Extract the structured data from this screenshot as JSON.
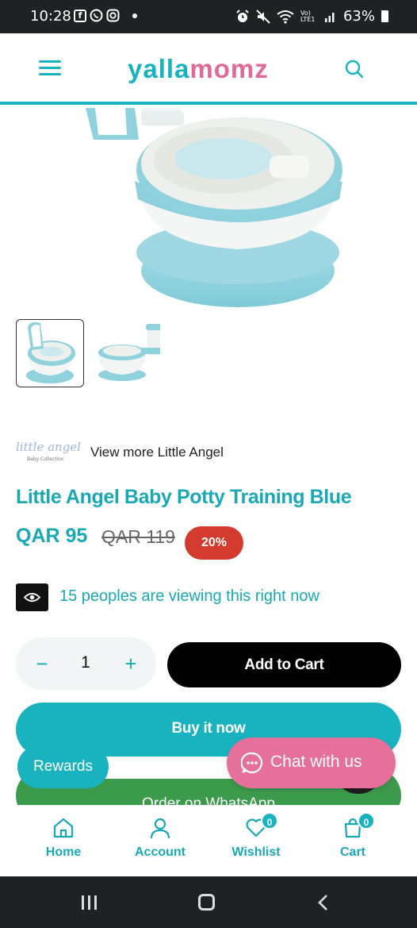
{
  "status_bar": {
    "time": "10:28",
    "battery": "63%",
    "icons": [
      "facebook-icon",
      "whatsapp-icon",
      "instagram-icon",
      "alarm-icon",
      "mute-icon",
      "wifi-icon",
      "signal-icon",
      "battery-icon"
    ],
    "network_label": "Vo) LTE1"
  },
  "header": {
    "logo_part1": "yalla",
    "logo_part2": "momz",
    "menu_icon": "hamburger-menu-icon",
    "search_icon": "search-icon"
  },
  "gallery": {
    "thumbnails": [
      "potty-thumbnail-front",
      "potty-thumbnail-side"
    ],
    "active_index": 0
  },
  "brand": {
    "logo_text": "little angel",
    "logo_subtext": "Baby Collection",
    "link": "View more Little Angel"
  },
  "product": {
    "title": "Little Angel Baby Potty Training Blue",
    "price": "QAR 95",
    "old_price": "QAR 119",
    "discount": "20%",
    "viewing_text": "15 peoples are viewing this right now"
  },
  "cart": {
    "quantity": "1",
    "minus": "−",
    "plus": "+",
    "add_to_cart": "Add to Cart",
    "buy_now": "Buy it now",
    "whatsapp": "Order on WhatsApp"
  },
  "floating": {
    "rewards": "Rewards",
    "chat": "Chat with us"
  },
  "bottom_nav": {
    "items": [
      {
        "label": "Home",
        "icon": "home-icon"
      },
      {
        "label": "Account",
        "icon": "account-icon"
      },
      {
        "label": "Wishlist",
        "icon": "heart-icon",
        "count": "0"
      },
      {
        "label": "Cart",
        "icon": "cart-icon",
        "count": "0"
      }
    ]
  },
  "colors": {
    "brand_teal": "#19b3bf",
    "brand_pink": "#e06a96",
    "discount_red": "#d33b2f",
    "whatsapp_green": "#3b9a4c",
    "chat_pink": "#e4709b"
  }
}
